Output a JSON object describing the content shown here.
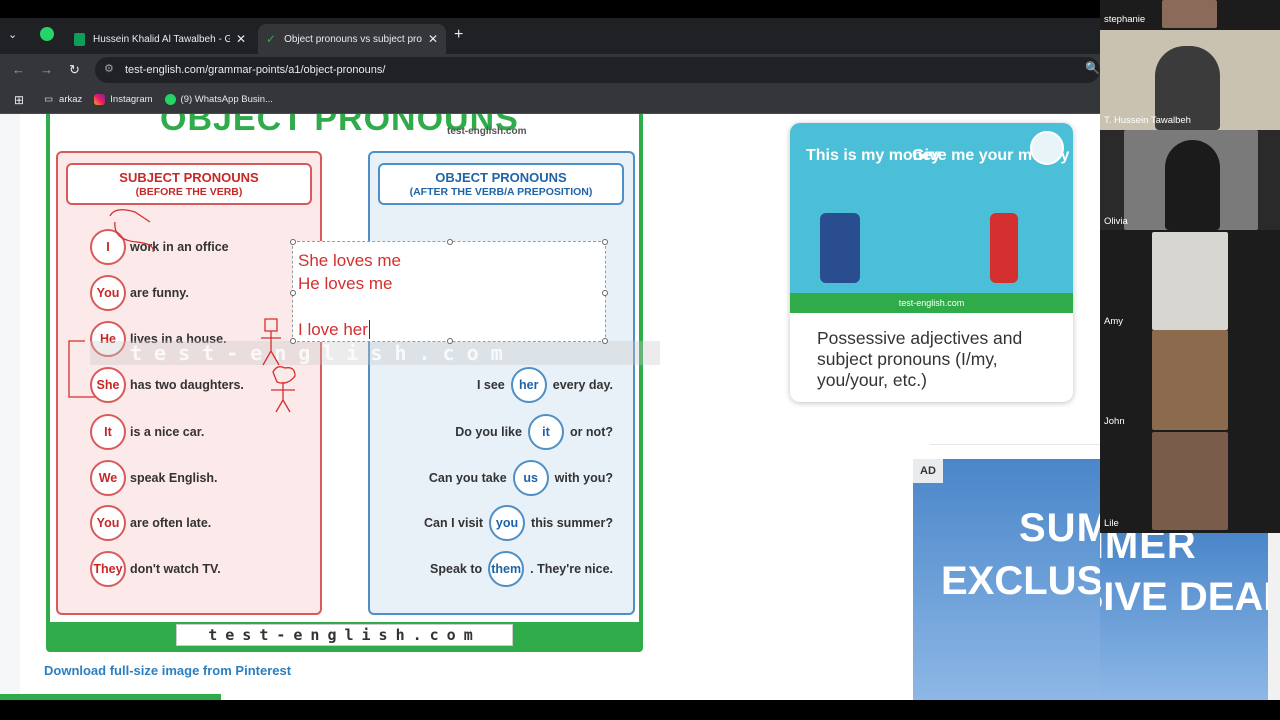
{
  "browser": {
    "tabs": [
      {
        "title": "Hussein Khalid Al Tawalbeh - G",
        "active": false
      },
      {
        "title": "Object pronouns vs subject pro",
        "active": true
      }
    ],
    "url": "test-english.com/grammar-points/a1/object-pronouns/",
    "bookmarks": [
      "arkaz",
      "Instagram",
      "(9) WhatsApp Busin..."
    ]
  },
  "graphic": {
    "banner": "OBJECT PRONOUNS",
    "brand": "test-english.com",
    "subject_header": "SUBJECT PRONOUNS",
    "subject_sub": "(BEFORE THE VERB)",
    "object_header": "OBJECT PRONOUNS",
    "object_sub": "(AFTER THE VERB/A PREPOSITION)",
    "subject_rows": [
      {
        "pronoun": "I",
        "rest": "work in an office"
      },
      {
        "pronoun": "You",
        "rest": "are funny."
      },
      {
        "pronoun": "He",
        "rest": "lives in a house."
      },
      {
        "pronoun": "She",
        "rest": "has two daughters."
      },
      {
        "pronoun": "It",
        "rest": "is a nice car."
      },
      {
        "pronoun": "We",
        "rest": "speak English."
      },
      {
        "pronoun": "You",
        "rest": "are often late."
      },
      {
        "pronoun": "They",
        "rest": "don't watch TV."
      }
    ],
    "object_rows": [
      {
        "before": "I see",
        "pronoun": "her",
        "after": "every day."
      },
      {
        "before": "Do you like",
        "pronoun": "it",
        "after": "or not?"
      },
      {
        "before": "Can you take",
        "pronoun": "us",
        "after": "with you?"
      },
      {
        "before": "Can I visit",
        "pronoun": "you",
        "after": "this summer?"
      },
      {
        "before": "Speak to",
        "pronoun": "them",
        "after": ". They're nice."
      }
    ],
    "watermark": "test-english.com",
    "bottom_brand": "test-english.com"
  },
  "textbox": {
    "line1": "She loves me",
    "line2": "He loves me",
    "line3": "I love her"
  },
  "download_link": "Download full-size image from Pinterest",
  "card": {
    "img_text1": "This is my money",
    "img_text2": "Give me your money",
    "img_footer": "test-english.com",
    "caption": "Possessive adjectives and subject pronouns (I/my, you/your, etc.)"
  },
  "ad": {
    "tag": "AD",
    "line1": "SUMMER",
    "line2": "EXCLUSIVE DEALS"
  },
  "participants": [
    {
      "name": "stephanie"
    },
    {
      "name": "T. Hussein Tawalbeh"
    },
    {
      "name": "Olivia"
    },
    {
      "name": "Amy"
    },
    {
      "name": "John"
    },
    {
      "name": "Lile"
    }
  ]
}
